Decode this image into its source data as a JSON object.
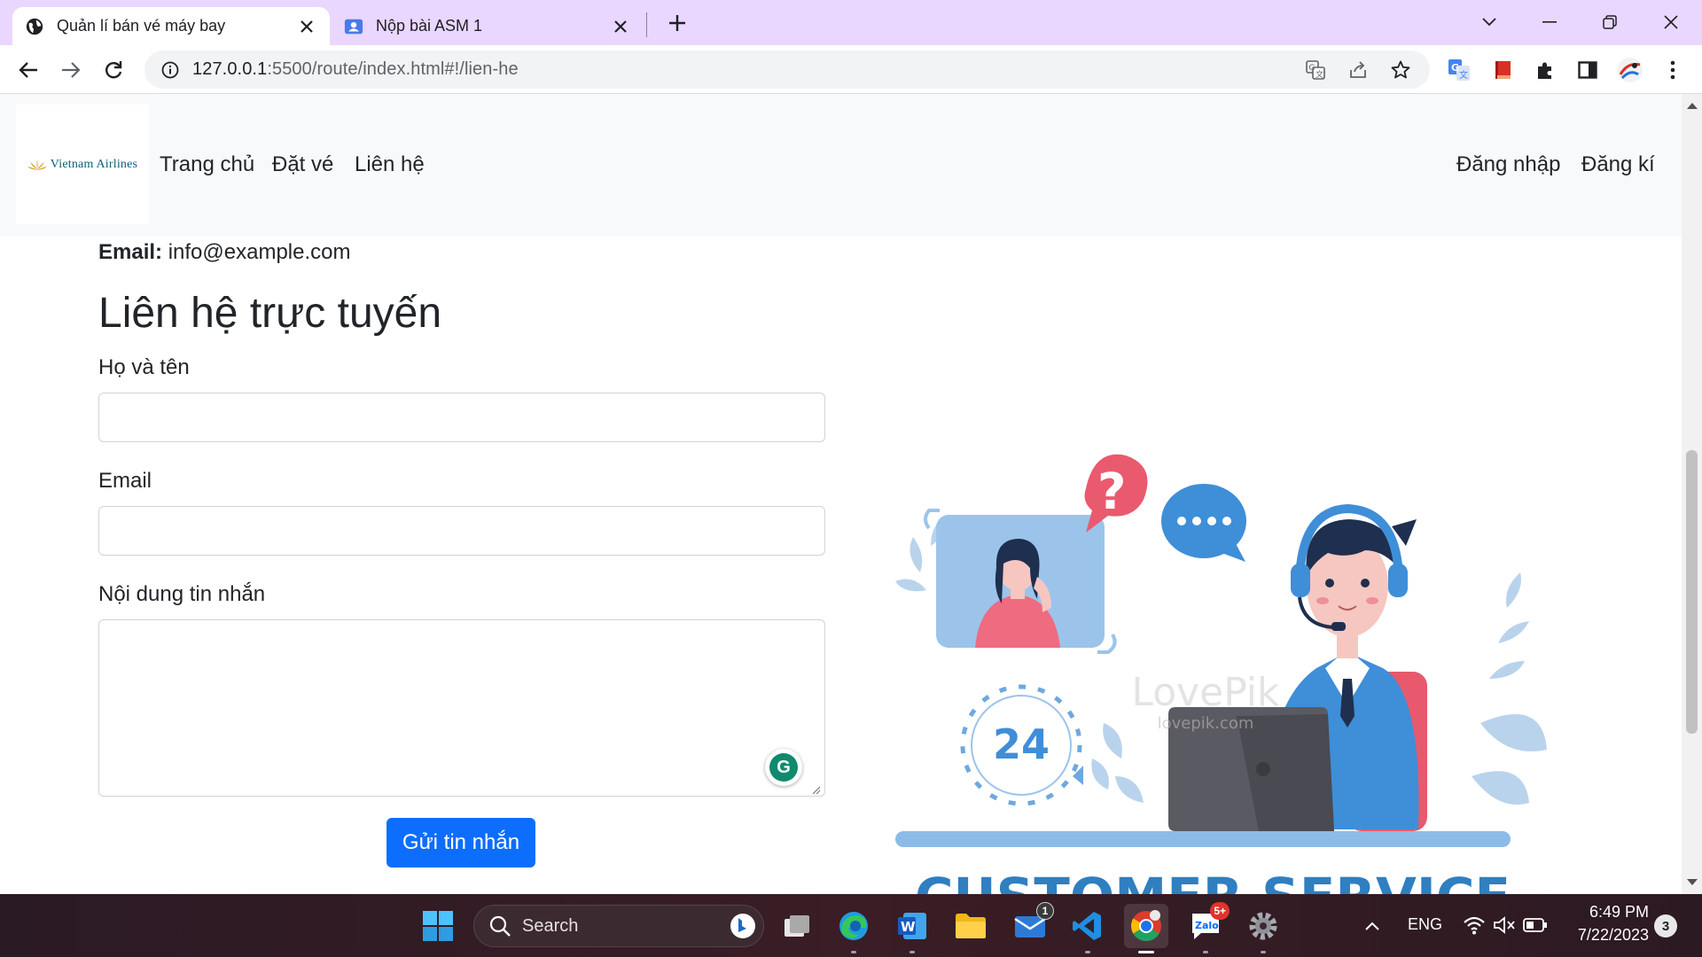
{
  "browser": {
    "tabs": [
      {
        "title": "Quản lí bán vé máy bay",
        "active": true
      },
      {
        "title": "Nộp bài ASM 1",
        "active": false
      }
    ],
    "url_host": "127.0.0.1",
    "url_rest": ":5500/route/index.html#!/lien-he"
  },
  "navbar": {
    "logo_text": "Vietnam Airlines",
    "links": [
      "Trang chủ",
      "Đặt vé",
      "Liên hệ"
    ],
    "login": "Đăng nhập",
    "register": "Đăng kí"
  },
  "contact": {
    "email_label": "Email:",
    "email_value": "info@example.com",
    "heading": "Liên hệ trực tuyến",
    "name_label": "Họ và tên",
    "email_field_label": "Email",
    "message_label": "Nội dung tin nhắn",
    "submit": "Gửi tin nhắn"
  },
  "illustration": {
    "caption": "CUSTOMER SERVICE",
    "clock_number": "24",
    "watermark": "LovePik",
    "watermark_url": "lovepik.com"
  },
  "taskbar": {
    "search_placeholder": "Search",
    "mail_badge": "1",
    "zalo_badge": "5+",
    "zalo_label": "Zalo",
    "language": "ENG",
    "time": "6:49 PM",
    "date": "7/22/2023",
    "notifications": "3"
  },
  "colors": {
    "tabstrip": "#e9d7ff",
    "primary_button": "#0d6efd",
    "navbar_bg": "#f8f9fa",
    "illustration_blue": "#2f7fc1"
  }
}
